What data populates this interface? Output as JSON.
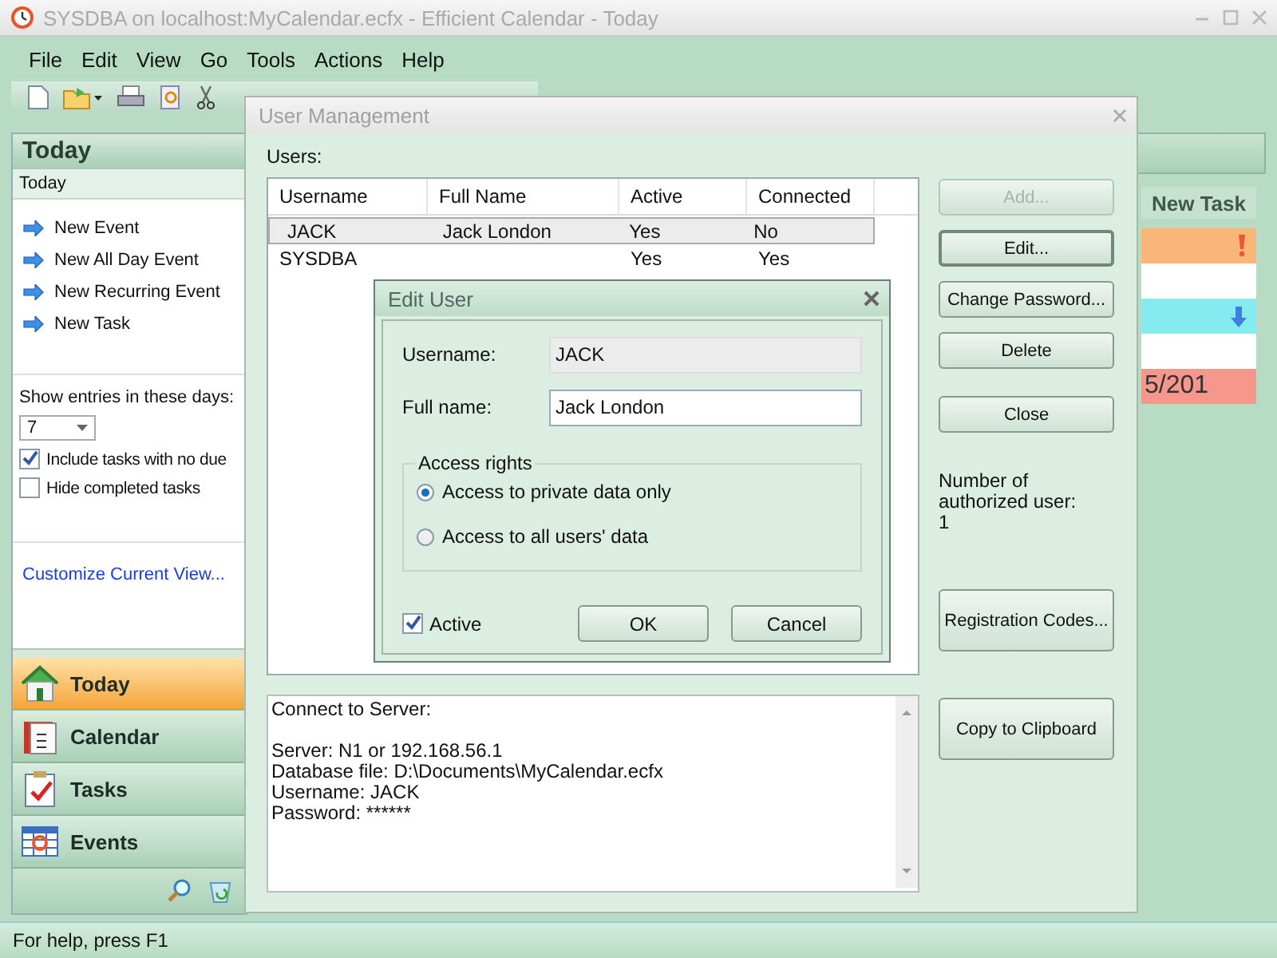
{
  "window": {
    "title": "SYSDBA on localhost:MyCalendar.ecfx - Efficient Calendar - Today"
  },
  "menu": [
    "File",
    "Edit",
    "View",
    "Go",
    "Tools",
    "Actions",
    "Help"
  ],
  "sidebar": {
    "header": "Today",
    "subheader": "Today",
    "actions": [
      "New Event",
      "New All Day Event",
      "New Recurring Event",
      "New Task"
    ],
    "days_label": "Show entries in these days:",
    "days_value": "7",
    "options": [
      {
        "label": "Include tasks with no due",
        "checked": true
      },
      {
        "label": "Hide completed tasks",
        "checked": false
      }
    ],
    "customize_link": "Customize Current View...",
    "nav": [
      {
        "label": "Today",
        "kind": "home",
        "selected": true
      },
      {
        "label": "Calendar",
        "kind": "calendar",
        "selected": false
      },
      {
        "label": "Tasks",
        "kind": "tasks",
        "selected": false
      },
      {
        "label": "Events",
        "kind": "events",
        "selected": false
      }
    ]
  },
  "task_panel": {
    "header": "New Task",
    "rows": [
      {
        "color": "#f9b678",
        "kind": "high"
      },
      {
        "color": "#ffffff",
        "kind": "none"
      },
      {
        "color": "#86ebef",
        "kind": "low"
      },
      {
        "color": "#ffffff",
        "kind": "none"
      },
      {
        "color": "#f7968a",
        "kind": "text",
        "text": "5/201"
      }
    ]
  },
  "user_management": {
    "title": "User Management",
    "users_label": "Users:",
    "columns": [
      "Username",
      "Full Name",
      "Active",
      "Connected"
    ],
    "rows": [
      {
        "cells": [
          "JACK",
          "Jack London",
          "Yes",
          "No"
        ],
        "selected": true
      },
      {
        "cells": [
          "SYSDBA",
          "",
          "Yes",
          "Yes"
        ],
        "selected": false
      }
    ],
    "info": [
      "Connect to Server:",
      "Server: N1 or 192.168.56.1\nDatabase file: D:\\Documents\\MyCalendar.ecfx\nUsername: JACK\nPassword: ******"
    ],
    "buttons": [
      {
        "label": "Add...",
        "disabled": true,
        "default": false
      },
      {
        "label": "Edit...",
        "disabled": false,
        "default": true
      },
      {
        "label": "Change Password...",
        "disabled": false,
        "default": false
      },
      {
        "label": "Delete",
        "disabled": false,
        "default": false
      },
      {
        "label": "Close",
        "disabled": false,
        "default": false
      }
    ],
    "count_label": "Number of authorized user:",
    "count": "1",
    "lower_buttons": [
      "Registration Codes...",
      "Copy to Clipboard"
    ]
  },
  "edit_user": {
    "title": "Edit User",
    "username_label": "Username:",
    "username": "JACK",
    "fullname_label": "Full name:",
    "fullname": "Jack London",
    "group_label": "Access rights",
    "access": [
      {
        "label": "Access to private data only",
        "selected": true
      },
      {
        "label": "Access to all users' data",
        "selected": false
      }
    ],
    "active": {
      "label": "Active",
      "checked": true
    },
    "buttons": [
      "OK",
      "Cancel"
    ]
  },
  "status_bar": "For help, press F1"
}
